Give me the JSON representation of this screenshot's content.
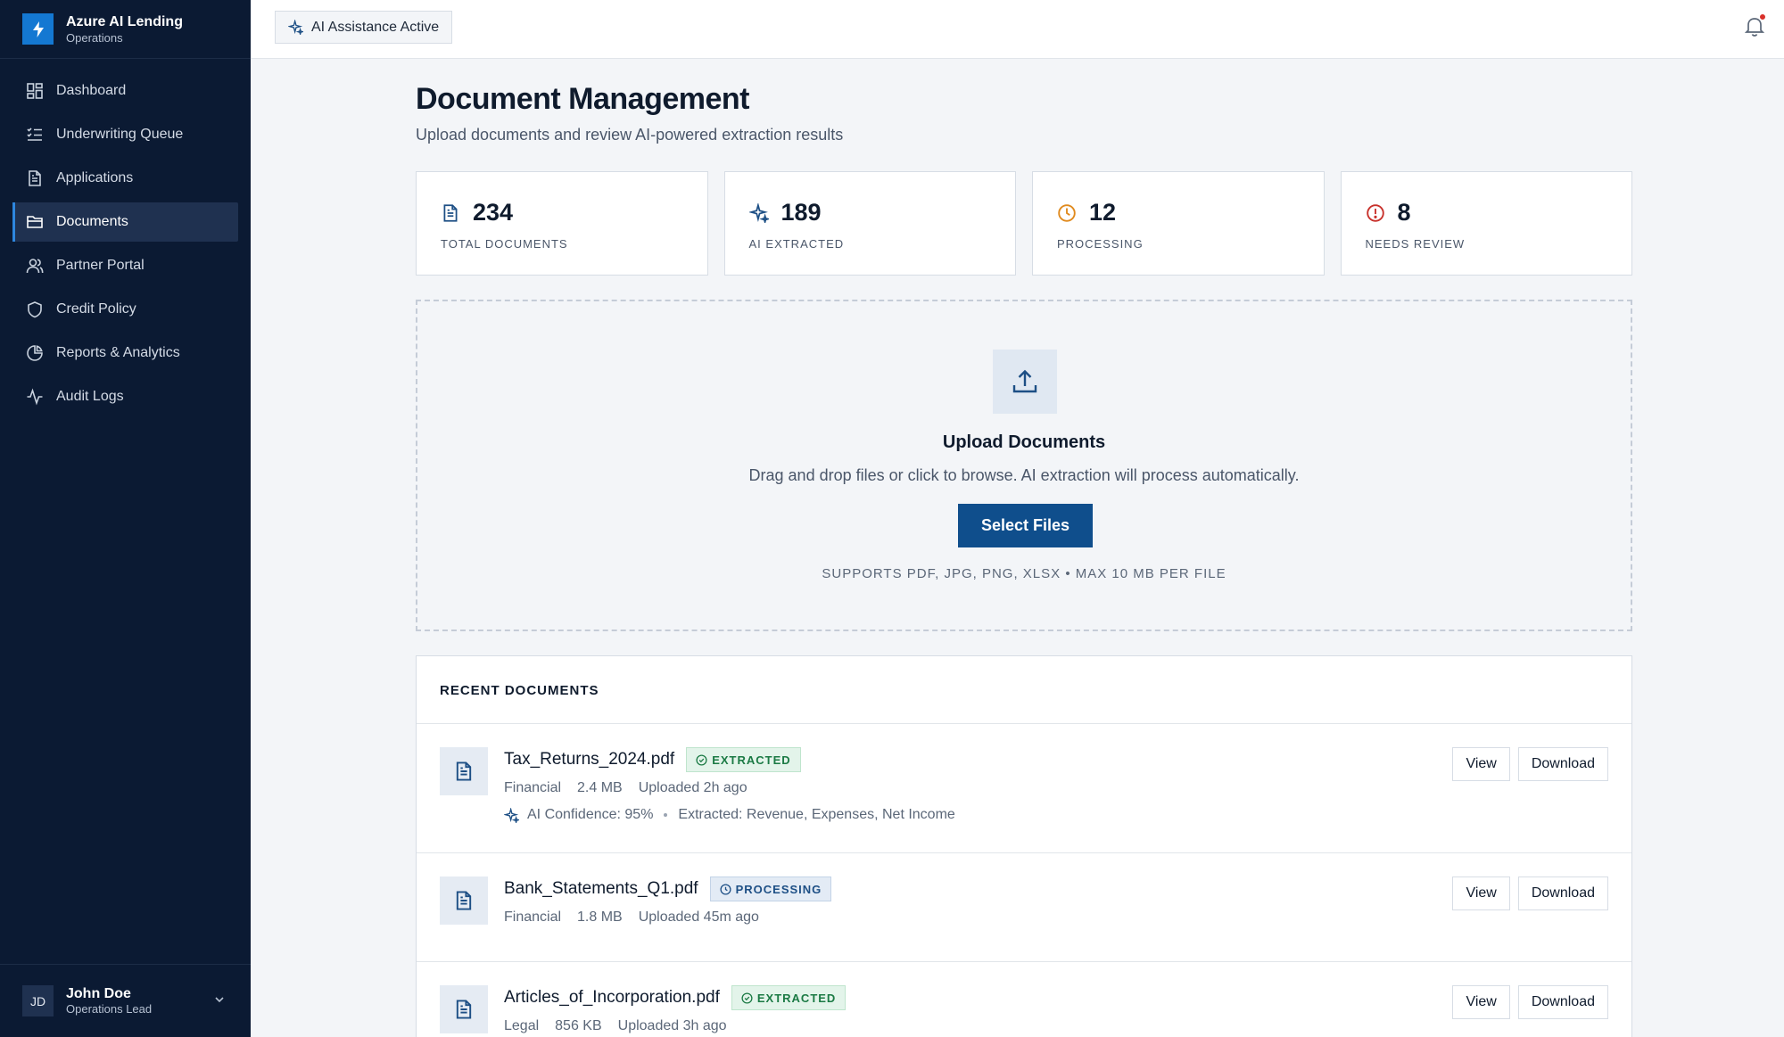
{
  "app": {
    "title": "Azure AI Lending",
    "subtitle": "Operations"
  },
  "sidebar": {
    "items": [
      {
        "label": "Dashboard",
        "icon": "dashboard-icon"
      },
      {
        "label": "Underwriting Queue",
        "icon": "list-check-icon"
      },
      {
        "label": "Applications",
        "icon": "file-icon"
      },
      {
        "label": "Documents",
        "icon": "folder-icon",
        "active": true
      },
      {
        "label": "Partner Portal",
        "icon": "users-icon"
      },
      {
        "label": "Credit Policy",
        "icon": "shield-icon"
      },
      {
        "label": "Reports & Analytics",
        "icon": "pie-chart-icon"
      },
      {
        "label": "Audit Logs",
        "icon": "activity-icon"
      }
    ]
  },
  "user": {
    "initials": "JD",
    "name": "John Doe",
    "role": "Operations Lead"
  },
  "topbar": {
    "ai_status": "AI Assistance Active"
  },
  "page": {
    "title": "Document Management",
    "subtitle": "Upload documents and review AI-powered extraction results"
  },
  "stats": [
    {
      "value": "234",
      "label": "TOTAL DOCUMENTS",
      "icon": "file-icon",
      "color": "#1d4f85"
    },
    {
      "value": "189",
      "label": "AI EXTRACTED",
      "icon": "sparkle-icon",
      "color": "#1d4f85"
    },
    {
      "value": "12",
      "label": "PROCESSING",
      "icon": "clock-icon",
      "color": "#e08a1e"
    },
    {
      "value": "8",
      "label": "NEEDS REVIEW",
      "icon": "alert-icon",
      "color": "#c8312b"
    }
  ],
  "upload": {
    "title": "Upload Documents",
    "description": "Drag and drop files or click to browse. AI extraction will process automatically.",
    "button": "Select Files",
    "note": "SUPPORTS PDF, JPG, PNG, XLSX • MAX 10 MB PER FILE"
  },
  "recent": {
    "heading": "RECENT DOCUMENTS",
    "view_label": "View",
    "download_label": "Download",
    "documents": [
      {
        "name": "Tax_Returns_2024.pdf",
        "status": "EXTRACTED",
        "category": "Financial",
        "size": "2.4 MB",
        "uploaded": "Uploaded 2h ago",
        "confidence": "AI Confidence: 95%",
        "extracted": "Extracted: Revenue, Expenses, Net Income"
      },
      {
        "name": "Bank_Statements_Q1.pdf",
        "status": "PROCESSING",
        "category": "Financial",
        "size": "1.8 MB",
        "uploaded": "Uploaded 45m ago"
      },
      {
        "name": "Articles_of_Incorporation.pdf",
        "status": "EXTRACTED",
        "category": "Legal",
        "size": "856 KB",
        "uploaded": "Uploaded 3h ago"
      }
    ]
  }
}
